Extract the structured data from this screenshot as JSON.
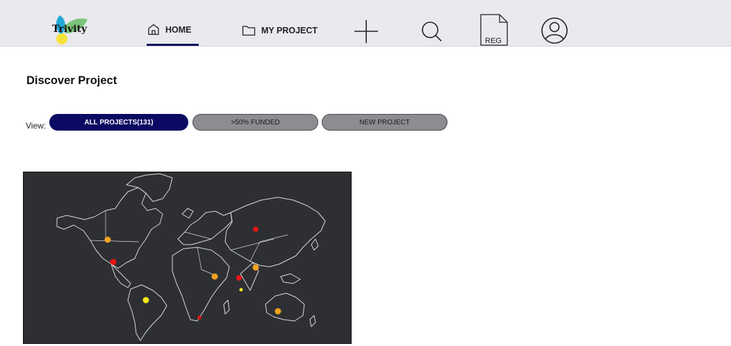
{
  "app": {
    "logo_text": "Trivity"
  },
  "nav": {
    "home_label": "HOME",
    "my_project_label": "MY PROJECT",
    "reg_label": "REG"
  },
  "page": {
    "title": "Discover Project"
  },
  "filters": {
    "view_label": "View:",
    "options": [
      {
        "label": "ALL PROJECTS(131)",
        "active": true
      },
      {
        "label": ">50% FUNDED",
        "active": false
      },
      {
        "label": "NEW PROJECT",
        "active": false
      }
    ]
  },
  "map": {
    "markers": [
      {
        "region": "Canada",
        "color": "#f4a21e"
      },
      {
        "region": "United States",
        "color": "#e81414"
      },
      {
        "region": "Brazil",
        "color": "#f7e51e"
      },
      {
        "region": "Russia",
        "color": "#e81414"
      },
      {
        "region": "East Africa",
        "color": "#f4a21e"
      },
      {
        "region": "India",
        "color": "#e81414"
      },
      {
        "region": "China",
        "color": "#f4a21e"
      },
      {
        "region": "Indian Ocean",
        "color": "#f7e51e"
      },
      {
        "region": "South Africa",
        "color": "#e81414"
      },
      {
        "region": "Australia",
        "color": "#f4a21e"
      }
    ]
  },
  "colors": {
    "accent": "#0b0a63",
    "inactive_pill": "#8c8c91",
    "topbar": "#e9e9ee",
    "map_bg": "#2d2f33"
  }
}
